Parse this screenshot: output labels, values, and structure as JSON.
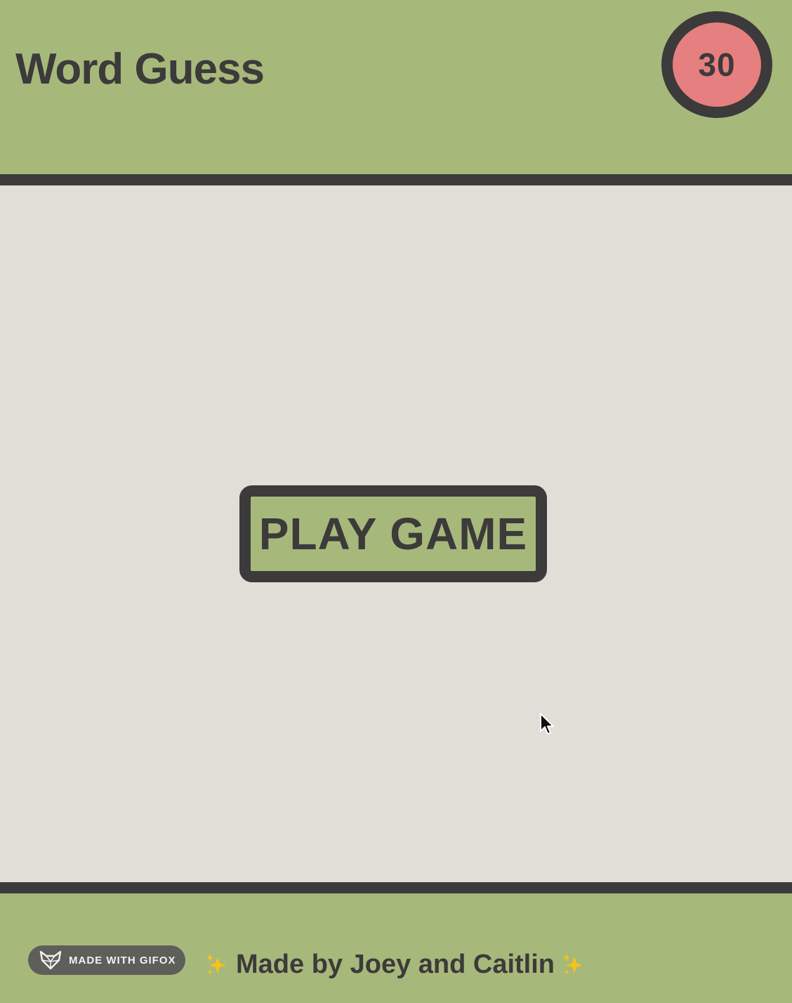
{
  "header": {
    "title": "Word Guess",
    "timer_value": "30"
  },
  "main": {
    "play_button_label": "PLAY GAME"
  },
  "footer": {
    "badge_label": "MADE WITH GIFOX",
    "credits": "Made by Joey and Caitlin"
  },
  "icons": {
    "cursor": "mouse-pointer-icon",
    "badge": "fox-icon",
    "sparkle": "sparkles-icon"
  },
  "colors": {
    "header_bg": "#a6b97b",
    "main_bg": "#e1ded8",
    "dark": "#3c3a3a",
    "timer_bg": "#e67f7f"
  }
}
